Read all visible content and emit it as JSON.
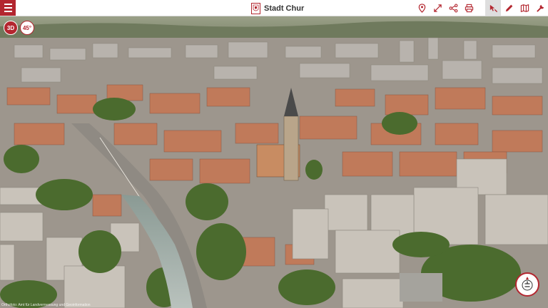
{
  "header": {
    "title": "Stadt Chur",
    "crest_icon": "city-crest-icon",
    "menu_icon": "hamburger-menu-icon"
  },
  "toolbar": {
    "tools": [
      {
        "name": "location-pin-icon"
      },
      {
        "name": "fullscreen-expand-icon"
      },
      {
        "name": "share-icon"
      },
      {
        "name": "print-icon"
      },
      {
        "name": "select-cursor-icon",
        "active": true
      },
      {
        "name": "draw-pencil-icon"
      },
      {
        "name": "map-book-icon"
      },
      {
        "name": "tools-wrench-icon"
      }
    ]
  },
  "view_controls": {
    "mode_label": "3D",
    "tilt_label": "45°"
  },
  "map": {
    "attribution": "Orthofoto: Amt für Landvermessung und Geoinformation"
  },
  "colors": {
    "brand": "#b3262f",
    "toolbar_bg": "#ffffff",
    "active_tool_bg": "#dedede"
  }
}
